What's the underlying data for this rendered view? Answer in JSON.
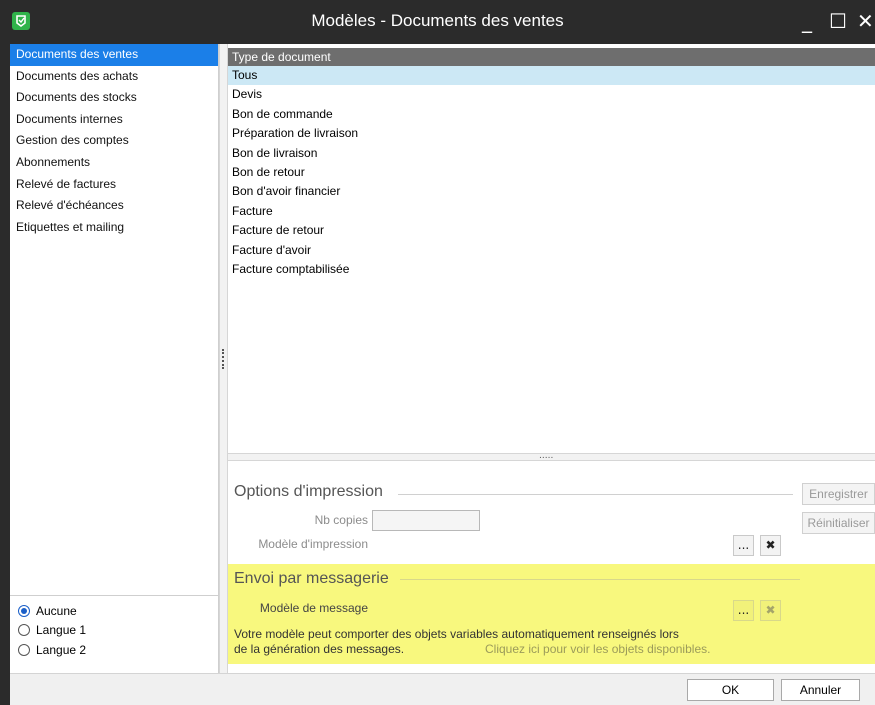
{
  "window": {
    "title": "Modèles - Documents des ventes",
    "minimize": "_",
    "maximize": "☐",
    "close": "✕",
    "icon": "app-logo-icon",
    "accent": "#2fb34a"
  },
  "sidebar": {
    "items": [
      {
        "label": "Documents des ventes",
        "selected": true
      },
      {
        "label": "Documents des achats"
      },
      {
        "label": "Documents des stocks"
      },
      {
        "label": "Documents internes"
      },
      {
        "label": "Gestion des comptes"
      },
      {
        "label": "Abonnements"
      },
      {
        "label": "Relevé de factures"
      },
      {
        "label": "Relevé d'échéances"
      },
      {
        "label": "Etiquettes et mailing"
      }
    ],
    "language_options": [
      {
        "label": "Aucune",
        "checked": true
      },
      {
        "label": "Langue 1",
        "checked": false
      },
      {
        "label": "Langue 2",
        "checked": false
      }
    ],
    "selected_color": "#1b7fe8"
  },
  "document_list": {
    "column_header": "Type de document",
    "rows": [
      {
        "label": "Tous",
        "selected": true
      },
      {
        "label": "Devis"
      },
      {
        "label": "Bon de commande"
      },
      {
        "label": "Préparation de livraison"
      },
      {
        "label": "Bon de livraison"
      },
      {
        "label": "Bon de retour"
      },
      {
        "label": "Bon d'avoir financier"
      },
      {
        "label": "Facture"
      },
      {
        "label": "Facture de retour"
      },
      {
        "label": "Facture d'avoir"
      },
      {
        "label": "Facture comptabilisée"
      }
    ],
    "splitter_grip": "....."
  },
  "print_options": {
    "title": "Options d'impression",
    "copies_label": "Nb copies",
    "copies_value": "",
    "template_label": "Modèle d'impression",
    "browse_label": "...",
    "clear_label": "✖",
    "save_label": "Enregistrer",
    "reset_label": "Réinitialiser"
  },
  "email": {
    "title": "Envoi par messagerie",
    "template_label": "Modèle de message",
    "browse_label": "...",
    "clear_label": "✖",
    "info_line1": "Votre modèle peut comporter des objets variables automatiquement renseignés lors",
    "info_line2": "de la génération des messages.",
    "link": "Cliquez ici pour voir les objets disponibles.",
    "highlight_color": "#f8f87e"
  },
  "footer": {
    "ok_label": "OK",
    "cancel_label": "Annuler"
  }
}
